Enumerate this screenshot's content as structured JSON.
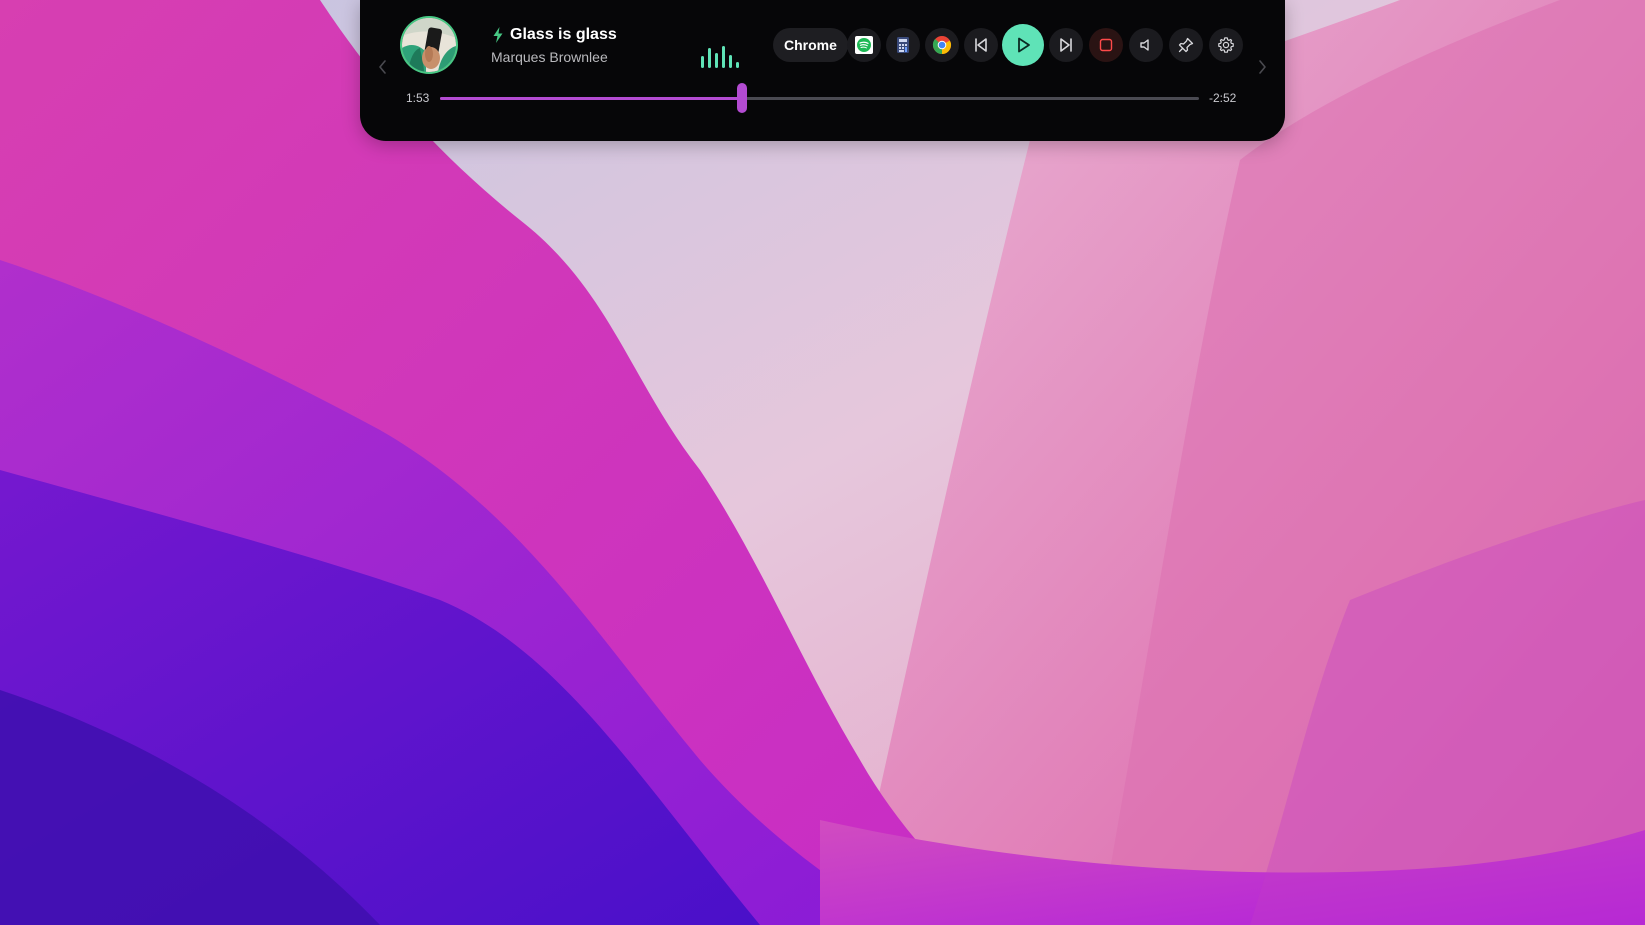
{
  "media_player": {
    "track": {
      "title": "Glass is glass",
      "artist": "Marques Brownlee"
    },
    "source_app": "Chrome",
    "playback": {
      "elapsed": "1:53",
      "remaining": "-2:52",
      "progress_fraction": 0.398
    },
    "icons": {
      "prev_nav": "chevron-left-icon",
      "next_nav": "chevron-right-icon",
      "bolt": "bolt-icon",
      "visualizer": "audio-visualizer-icon",
      "app_1": "spotify-icon",
      "app_2": "calculator-icon",
      "app_3": "chrome-icon",
      "previous": "skip-previous-icon",
      "play": "play-icon",
      "next": "skip-next-icon",
      "stop": "stop-icon",
      "volume": "volume-icon",
      "pin": "pin-icon",
      "settings": "gear-icon"
    },
    "colors": {
      "accent_green": "#5fe3b7",
      "progress_purple": "#b34bd2",
      "island_background": "#060608",
      "stop_red": "#ff4a4a"
    }
  }
}
